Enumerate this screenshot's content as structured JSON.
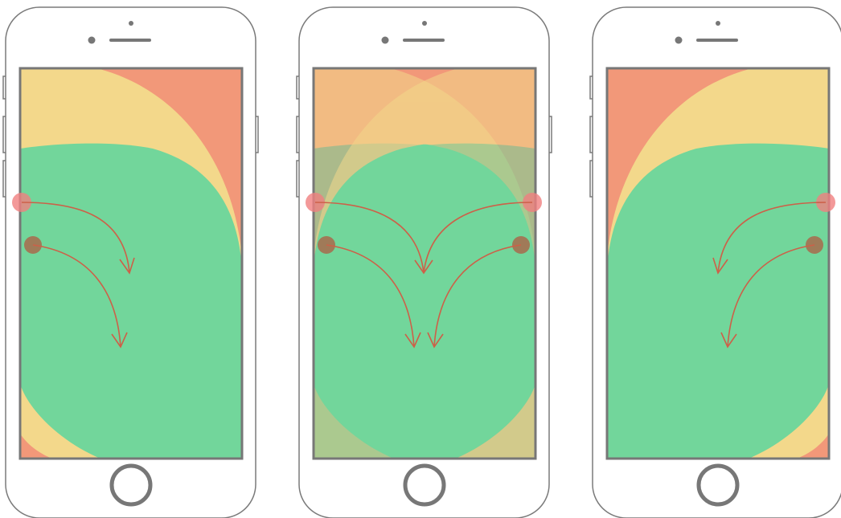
{
  "colors": {
    "background": "#ffffff",
    "phone_outline": "#7a7a7a",
    "screen_border": "#777777",
    "zone_easy": "#72d69b",
    "zone_ok": "#f3d88b",
    "zone_hard": "#f29879",
    "arrow": "#cd6048",
    "thumb_dot_pink": "#f07f7f",
    "thumb_dot_dark": "#a86a4c"
  },
  "phones": [
    {
      "id": "left-hand",
      "hand": "left"
    },
    {
      "id": "both-hands",
      "hand": "both"
    },
    {
      "id": "right-hand",
      "hand": "right"
    }
  ]
}
